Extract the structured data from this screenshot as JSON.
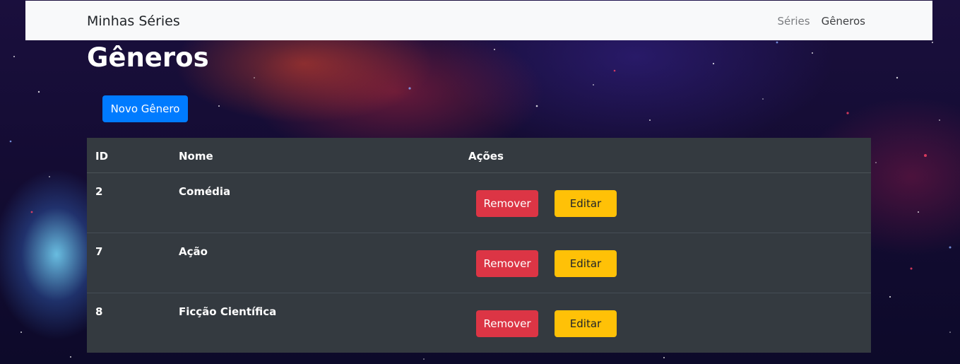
{
  "navbar": {
    "brand": "Minhas Séries",
    "links": [
      {
        "label": "Séries"
      },
      {
        "label": "Gêneros"
      }
    ]
  },
  "page": {
    "title": "Gêneros",
    "new_button": "Novo Gênero"
  },
  "table": {
    "headers": {
      "id": "ID",
      "name": "Nome",
      "actions": "Ações"
    },
    "rows": [
      {
        "id": "2",
        "name": "Comédia",
        "remove": "Remover",
        "edit": "Editar"
      },
      {
        "id": "7",
        "name": "Ação",
        "remove": "Remover",
        "edit": "Editar"
      },
      {
        "id": "8",
        "name": "Ficção Científica",
        "remove": "Remover",
        "edit": "Editar"
      }
    ]
  },
  "colors": {
    "primary": "#007bff",
    "danger": "#dc3545",
    "warning": "#ffc107",
    "table_bg": "#343a40",
    "navbar_bg": "#f8f9fa"
  }
}
